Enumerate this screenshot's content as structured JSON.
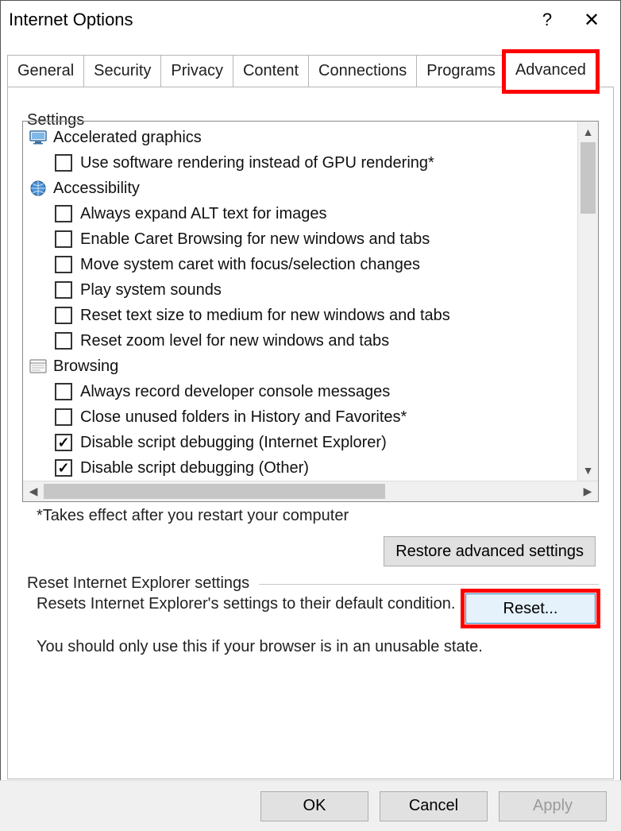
{
  "window": {
    "title": "Internet Options",
    "help_symbol": "?",
    "close_symbol": "✕"
  },
  "tabs": [
    {
      "label": "General",
      "active": false
    },
    {
      "label": "Security",
      "active": false
    },
    {
      "label": "Privacy",
      "active": false
    },
    {
      "label": "Content",
      "active": false
    },
    {
      "label": "Connections",
      "active": false
    },
    {
      "label": "Programs",
      "active": false
    },
    {
      "label": "Advanced",
      "active": true
    }
  ],
  "settings": {
    "group_label": "Settings",
    "categories": [
      {
        "icon": "monitor-icon",
        "label": "Accelerated graphics",
        "options": [
          {
            "label": "Use software rendering instead of GPU rendering*",
            "checked": false
          }
        ]
      },
      {
        "icon": "globe-icon",
        "label": "Accessibility",
        "options": [
          {
            "label": "Always expand ALT text for images",
            "checked": false
          },
          {
            "label": "Enable Caret Browsing for new windows and tabs",
            "checked": false
          },
          {
            "label": "Move system caret with focus/selection changes",
            "checked": false
          },
          {
            "label": "Play system sounds",
            "checked": false
          },
          {
            "label": "Reset text size to medium for new windows and tabs",
            "checked": false
          },
          {
            "label": "Reset zoom level for new windows and tabs",
            "checked": false
          }
        ]
      },
      {
        "icon": "browsing-icon",
        "label": "Browsing",
        "options": [
          {
            "label": "Always record developer console messages",
            "checked": false
          },
          {
            "label": "Close unused folders in History and Favorites*",
            "checked": false
          },
          {
            "label": "Disable script debugging (Internet Explorer)",
            "checked": true
          },
          {
            "label": "Disable script debugging (Other)",
            "checked": true
          }
        ]
      }
    ],
    "footnote": "*Takes effect after you restart your computer",
    "restore_button": "Restore advanced settings"
  },
  "reset": {
    "group_label": "Reset Internet Explorer settings",
    "description": "Resets Internet Explorer's settings to their default condition.",
    "button": "Reset...",
    "hint": "You should only use this if your browser is in an unusable state."
  },
  "footer": {
    "ok": "OK",
    "cancel": "Cancel",
    "apply": "Apply"
  }
}
